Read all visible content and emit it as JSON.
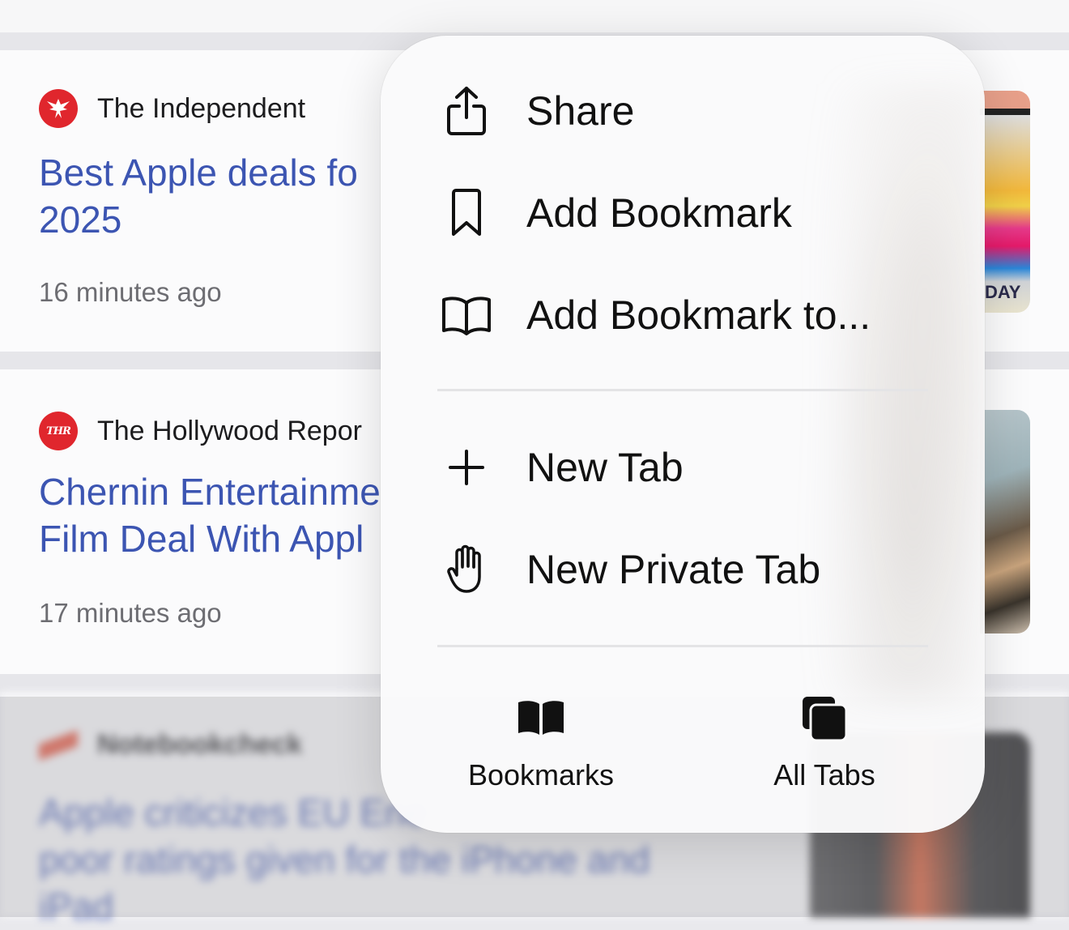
{
  "feed": {
    "articles": [
      {
        "source": "The Independent",
        "headline_lines": [
          "Best Apple deals fo",
          "2025"
        ],
        "time": "16 minutes ago"
      },
      {
        "source": "The Hollywood Repor",
        "logo_text": "THR",
        "headline_lines": [
          "Chernin Entertainme",
          "Film Deal With Appl"
        ],
        "time": "17 minutes ago"
      },
      {
        "source": "Notebookcheck",
        "headline_lines": [
          "Apple criticizes EU Ene",
          "poor ratings given for the iPhone and",
          "iPad"
        ]
      }
    ],
    "thumb_caption": "DAY"
  },
  "menu": {
    "items": [
      {
        "label": "Share",
        "icon": "share-icon"
      },
      {
        "label": "Add Bookmark",
        "icon": "bookmark-icon"
      },
      {
        "label": "Add Bookmark to...",
        "icon": "book-icon"
      },
      {
        "label": "New Tab",
        "icon": "plus-icon"
      },
      {
        "label": "New Private Tab",
        "icon": "hand-icon"
      }
    ],
    "bottom": [
      {
        "label": "Bookmarks",
        "icon": "book-filled-icon"
      },
      {
        "label": "All Tabs",
        "icon": "tabs-icon"
      }
    ]
  },
  "colors": {
    "link": "#3c55b2",
    "source_logo": "#e0262d",
    "menu_bg": "#fafafb"
  }
}
